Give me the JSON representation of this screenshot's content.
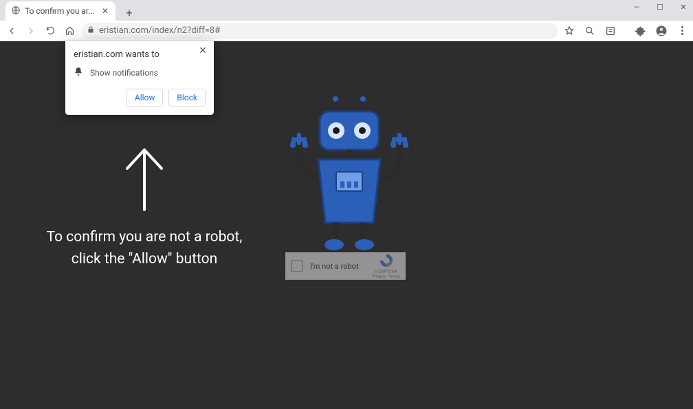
{
  "tab": {
    "title": "To confirm you are not a robot, c"
  },
  "address": {
    "domain": "eristian.com",
    "path": "/index/n2?diff=8#"
  },
  "popup": {
    "host_line": "eristian.com wants to",
    "permission_label": "Show notifications",
    "allow_label": "Allow",
    "block_label": "Block"
  },
  "page": {
    "line1": "To confirm you are not a robot,",
    "line2": "click the \"Allow\" button"
  },
  "captcha": {
    "label": "I'm not a robot",
    "brand": "reCAPTCHA",
    "legal": "Privacy - Terms"
  }
}
